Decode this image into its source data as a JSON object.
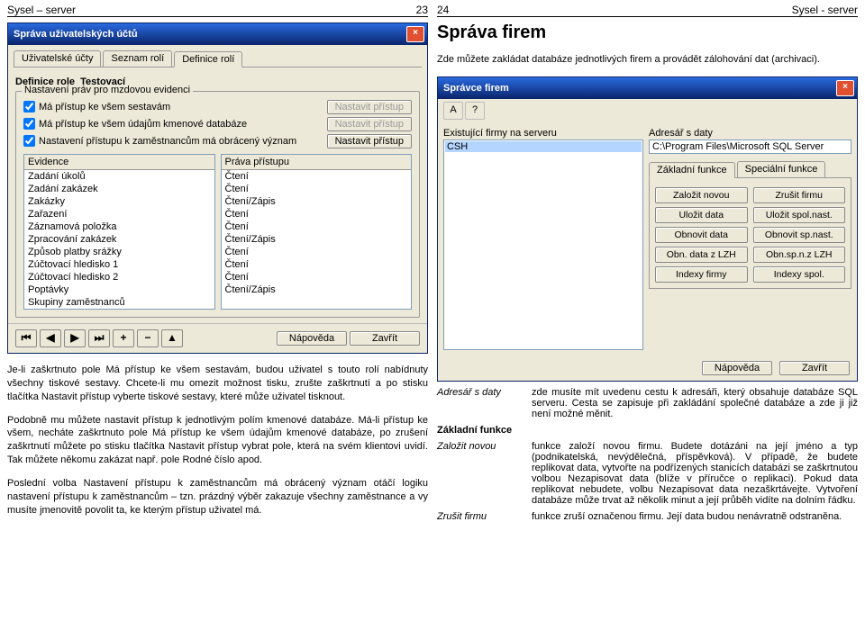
{
  "left": {
    "header_left": "Sysel – server",
    "header_right": "23",
    "dialog": {
      "title": "Správa uživatelských účtů",
      "tabs": [
        "Uživatelské účty",
        "Seznam rolí",
        "Definice rolí"
      ],
      "role_label": "Definice role",
      "role_value": "Testovací",
      "groupbox": "Nastavení práv pro mzdovou evidenci",
      "chk1": "Má přístup ke všem sestavám",
      "chk2": "Má přístup ke všem údajům kmenové databáze",
      "chk3": "Nastavení přístupu k zaměstnancům má obrácený význam",
      "btn_access": "Nastavit přístup",
      "col1": "Evidence",
      "col2": "Práva přístupu",
      "rows": [
        {
          "e": "Zadání úkolů",
          "p": "Čtení"
        },
        {
          "e": "Zadání zakázek",
          "p": "Čtení"
        },
        {
          "e": "Zakázky",
          "p": "Čtení/Zápis"
        },
        {
          "e": "Zařazení",
          "p": "Čtení"
        },
        {
          "e": "Záznamová položka",
          "p": "Čtení"
        },
        {
          "e": "Zpracování zakázek",
          "p": "Čtení/Zápis"
        },
        {
          "e": "Způsob platby srážky",
          "p": "Čtení"
        },
        {
          "e": "Zúčtovací hledisko 1",
          "p": "Čtení"
        },
        {
          "e": "Zúčtovací hledisko 2",
          "p": "Čtení"
        },
        {
          "e": "Poptávky",
          "p": "Čtení/Zápis"
        },
        {
          "e": "Skupiny zaměstnanců",
          "p": ""
        }
      ],
      "nav_help": "Nápověda",
      "nav_close": "Zavřít"
    },
    "para1": "Je-li zaškrtnuto pole Má přístup ke všem sestavám, budou uživatel s touto rolí nabídnuty všechny tiskové sestavy. Chcete-li mu omezit možnost tisku, zrušte zaškrtnutí a po stisku tlačítka Nastavit přístup vyberte tiskové sestavy, které může uživatel tisknout.",
    "para2": "Podobně mu můžete nastavit přístup k jednotlivým polím kmenové databáze. Má-li přístup ke všem, necháte zaškrtnuto pole Má přístup ke všem údajům kmenové databáze, po zrušení zaškrtnutí můžete po stisku tlačítka Nastavit přístup vybrat pole, která na svém klientovi uvidí. Tak můžete někomu zakázat např. pole Rodné číslo apod.",
    "para3": "Poslední volba Nastavení přístupu k zaměstnancům má obrácený význam otáčí logiku nastavení přístupu k zaměstnancům – tzn. prázdný výběr zakazuje všechny zaměstnance a vy musíte jmenovitě povolit ta, ke kterým přístup uživatel má."
  },
  "right": {
    "header_left": "24",
    "header_right": "Sysel - server",
    "title": "Správa firem",
    "intro": "Zde můžete zakládat databáze jednotlivých firem a provádět zálohování dat (archivaci).",
    "dialog": {
      "title": "Správce firem",
      "left_label": "Existující firmy na serveru",
      "firm": "CSH",
      "right_label": "Adresář s daty",
      "path": "C:\\Program Files\\Microsoft SQL Server",
      "tabs": [
        "Základní funkce",
        "Speciální funkce"
      ],
      "btns": [
        [
          "Založit novou",
          "Zrušit firmu"
        ],
        [
          "Uložit data",
          "Uložit spol.nast."
        ],
        [
          "Obnovit data",
          "Obnovit sp.nast."
        ],
        [
          "Obn. data z LZH",
          "Obn.sp.n.z LZH"
        ],
        [
          "Indexy firmy",
          "Indexy spol."
        ]
      ],
      "help": "Nápověda",
      "close": "Zavřít"
    },
    "defs": [
      {
        "term": "Adresář s daty",
        "desc": "zde musíte mít uvedenu cestu k adresáři, který obsahuje databáze SQL serveru. Cesta se zapisuje při zakládání společné databáze a zde ji již není možné měnit."
      },
      {
        "term": "Základní funkce",
        "desc": "",
        "head": true
      },
      {
        "term": "Založit novou",
        "desc": "funkce založí novou firmu. Budete dotázáni na její jméno a typ (podnikatelská, nevýdělečná, příspěvková). V případě, že budete replikovat data, vytvořte na podřízených stanicích databázi se zaškrtnutou volbou Nezapisovat data (blíže v příručce o replikaci). Pokud data replikovat nebudete, volbu Nezapisovat data nezaškrtávejte. Vytvoření databáze může trvat až několik minut a její průběh vidíte na dolním řádku."
      },
      {
        "term": "Zrušit firmu",
        "desc": "funkce zruší označenou firmu. Její data budou nenávratně odstraněna."
      }
    ]
  }
}
